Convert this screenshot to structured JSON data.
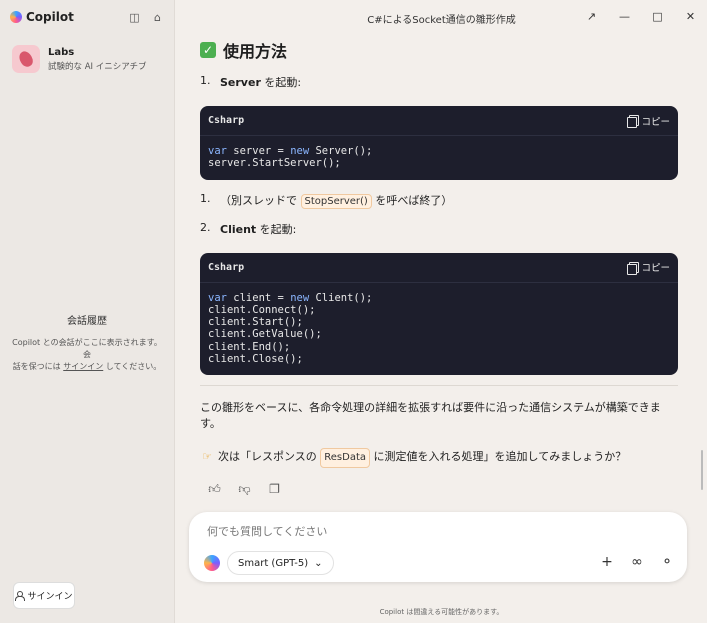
{
  "sidebar": {
    "app_name": "Copilot",
    "labs_title": "Labs",
    "labs_subtitle": "試験的な AI イニシアチブ",
    "history_title": "会話履歴",
    "history_text_1": "Copilot との会話がここに表示されます。会",
    "history_text_2": "話を保つには",
    "history_link": "サインイン",
    "history_text_3": "してください。",
    "signin_label": "サインイン"
  },
  "window": {
    "title": "C#によるSocket通信の雛形作成"
  },
  "content": {
    "section_title": "使用方法",
    "item1_num": "1.",
    "item1_bold": "Server",
    "item1_rest": " を起動:",
    "code1": {
      "lang": "Csharp",
      "copy_label": "コピー",
      "lines": [
        {
          "kw": "var",
          "rest": " server = ",
          "kw2": "new",
          "rest2": " Server();"
        },
        {
          "kw": "",
          "rest": "server.StartServer();",
          "kw2": "",
          "rest2": ""
        }
      ]
    },
    "note_num": "1.",
    "note_pre": "（別スレッドで ",
    "note_code": "StopServer()",
    "note_post": " を呼べば終了）",
    "item2_num": "2.",
    "item2_bold": "Client",
    "item2_rest": " を起動:",
    "code2": {
      "lang": "Csharp",
      "copy_label": "コピー",
      "lines": [
        {
          "kw": "var",
          "rest": " client = ",
          "kw2": "new",
          "rest2": " Client();"
        },
        {
          "kw": "",
          "rest": "client.Connect();",
          "kw2": "",
          "rest2": ""
        },
        {
          "kw": "",
          "rest": "client.Start();",
          "kw2": "",
          "rest2": ""
        },
        {
          "kw": "",
          "rest": "client.GetValue();",
          "kw2": "",
          "rest2": ""
        },
        {
          "kw": "",
          "rest": "client.End();",
          "kw2": "",
          "rest2": ""
        },
        {
          "kw": "",
          "rest": "client.Close();",
          "kw2": "",
          "rest2": ""
        }
      ]
    },
    "summary": "この雛形をベースに、各命令処理の詳細を拡張すれば要件に沿った通信システムが構築できます。",
    "followup_pre": "次は「レスポンスの ",
    "followup_code": "ResData",
    "followup_post": " に測定値を入れる処理」を追加してみましょうか？"
  },
  "composer": {
    "placeholder": "何でも質問してください",
    "model_label": "Smart (GPT-5)"
  },
  "footer": {
    "note": "Copilot は間違える可能性があります。"
  },
  "colors": {
    "code_bg": "#1d1e2c",
    "keyword": "#8bb6ff",
    "check_green": "#4caf50"
  }
}
